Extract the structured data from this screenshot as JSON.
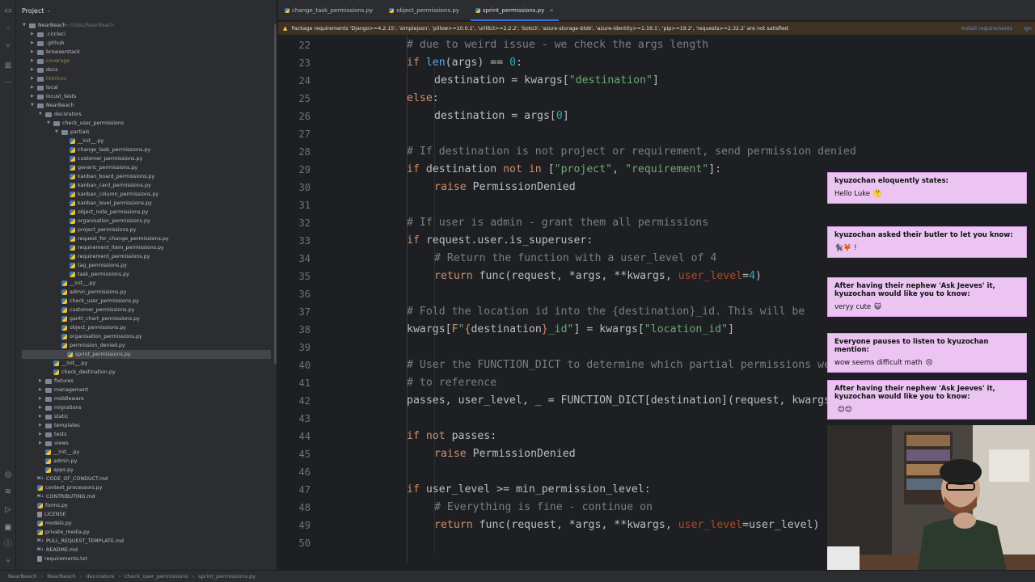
{
  "project": {
    "title": "Project",
    "root": "NearBeach",
    "root_path": "~/Sites/NearBeach",
    "tree": [
      {
        "label": "NearBeach",
        "kind": "folder",
        "depth": 0,
        "open": true
      },
      {
        "label": ".circleci",
        "kind": "folder",
        "depth": 1
      },
      {
        "label": ".github",
        "kind": "folder",
        "depth": 1
      },
      {
        "label": "browserstack",
        "kind": "folder",
        "depth": 1
      },
      {
        "label": "coverage",
        "kind": "folder",
        "depth": 1,
        "dim": true
      },
      {
        "label": "docs",
        "kind": "folder",
        "depth": 1
      },
      {
        "label": "htmlcov",
        "kind": "folder",
        "depth": 1,
        "dim": true
      },
      {
        "label": "local",
        "kind": "folder",
        "depth": 1
      },
      {
        "label": "locust_tests",
        "kind": "folder",
        "depth": 1
      },
      {
        "label": "NearBeach",
        "kind": "folder",
        "depth": 1,
        "open": true
      },
      {
        "label": "decorators",
        "kind": "folder",
        "depth": 2,
        "open": true
      },
      {
        "label": "check_user_permissions",
        "kind": "folder",
        "depth": 3,
        "open": true
      },
      {
        "label": "partials",
        "kind": "folder",
        "depth": 4,
        "open": true
      },
      {
        "label": "__init__.py",
        "kind": "py",
        "depth": 5
      },
      {
        "label": "change_task_permissions.py",
        "kind": "py",
        "depth": 5
      },
      {
        "label": "customer_permissions.py",
        "kind": "py",
        "depth": 5
      },
      {
        "label": "generic_permissions.py",
        "kind": "py",
        "depth": 5
      },
      {
        "label": "kanban_board_permissions.py",
        "kind": "py",
        "depth": 5
      },
      {
        "label": "kanban_card_permissions.py",
        "kind": "py",
        "depth": 5
      },
      {
        "label": "kanban_column_permissions.py",
        "kind": "py",
        "depth": 5
      },
      {
        "label": "kanban_level_permissions.py",
        "kind": "py",
        "depth": 5
      },
      {
        "label": "object_note_permissions.py",
        "kind": "py",
        "depth": 5
      },
      {
        "label": "organisation_permissions.py",
        "kind": "py",
        "depth": 5
      },
      {
        "label": "project_permissions.py",
        "kind": "py",
        "depth": 5
      },
      {
        "label": "request_for_change_permissions.py",
        "kind": "py",
        "depth": 5
      },
      {
        "label": "requirement_item_permissions.py",
        "kind": "py",
        "depth": 5
      },
      {
        "label": "requirement_permissions.py",
        "kind": "py",
        "depth": 5
      },
      {
        "label": "tag_permissions.py",
        "kind": "py",
        "depth": 5
      },
      {
        "label": "task_permissions.py",
        "kind": "py",
        "depth": 5
      },
      {
        "label": "__init__.py",
        "kind": "py",
        "depth": 4
      },
      {
        "label": "admin_permissions.py",
        "kind": "py",
        "depth": 4
      },
      {
        "label": "check_user_permissions.py",
        "kind": "py",
        "depth": 4
      },
      {
        "label": "customer_permissions.py",
        "kind": "py",
        "depth": 4
      },
      {
        "label": "gantt_chart_permissions.py",
        "kind": "py",
        "depth": 4
      },
      {
        "label": "object_permissions.py",
        "kind": "py",
        "depth": 4
      },
      {
        "label": "organisation_permissions.py",
        "kind": "py",
        "depth": 4
      },
      {
        "label": "permission_denied.py",
        "kind": "py",
        "depth": 4
      },
      {
        "label": "sprint_permissions.py",
        "kind": "py",
        "depth": 4,
        "selected": true
      },
      {
        "label": "__init__.py",
        "kind": "py",
        "depth": 3
      },
      {
        "label": "check_destination.py",
        "kind": "py",
        "depth": 3
      },
      {
        "label": "fixtures",
        "kind": "folder",
        "depth": 2
      },
      {
        "label": "management",
        "kind": "folder",
        "depth": 2
      },
      {
        "label": "middleware",
        "kind": "folder",
        "depth": 2
      },
      {
        "label": "migrations",
        "kind": "folder",
        "depth": 2
      },
      {
        "label": "static",
        "kind": "folder",
        "depth": 2
      },
      {
        "label": "templates",
        "kind": "folder",
        "depth": 2
      },
      {
        "label": "tests",
        "kind": "folder",
        "depth": 2
      },
      {
        "label": "views",
        "kind": "folder",
        "depth": 2
      },
      {
        "label": "__init__.py",
        "kind": "py",
        "depth": 2
      },
      {
        "label": "admin.py",
        "kind": "py",
        "depth": 2
      },
      {
        "label": "apps.py",
        "kind": "py",
        "depth": 2
      },
      {
        "label": "CODE_OF_CONDUCT.md",
        "kind": "md",
        "depth": 1
      },
      {
        "label": "context_processors.py",
        "kind": "py",
        "depth": 1
      },
      {
        "label": "CONTRIBUTING.md",
        "kind": "md",
        "depth": 1
      },
      {
        "label": "forms.py",
        "kind": "py",
        "depth": 1
      },
      {
        "label": "LICENSE",
        "kind": "txt",
        "depth": 1
      },
      {
        "label": "models.py",
        "kind": "py",
        "depth": 1
      },
      {
        "label": "private_media.py",
        "kind": "py",
        "depth": 1
      },
      {
        "label": "PULL_REQUEST_TEMPLATE.md",
        "kind": "md",
        "depth": 1
      },
      {
        "label": "README.md",
        "kind": "md",
        "depth": 1
      },
      {
        "label": "requirements.txt",
        "kind": "txt",
        "depth": 1
      }
    ]
  },
  "tabs": [
    {
      "label": "change_task_permissions.py",
      "active": false
    },
    {
      "label": "object_permissions.py",
      "active": false
    },
    {
      "label": "sprint_permissions.py",
      "active": true
    }
  ],
  "banner": {
    "text": "Package requirements 'Django>=4.2.15', 'simplejson', 'pillow>=10.0.1', 'urllib3>=2.2.2', 'boto3', 'azure-storage-blob', 'azure-identity>=1.16.1', 'pip>=19.2', 'requests>=2.32.2' are not satisfied",
    "action": "Install requirements",
    "action2": "Ign"
  },
  "code_lines": [
    {
      "n": "22",
      "indent": 0,
      "html": "<span class=\"cm\"># due to weird issue - we check the args length</span>"
    },
    {
      "n": "23",
      "indent": 0,
      "html": "<span class=\"kw\">if</span> <span class=\"fn\">len</span>(args) == <span class=\"num\">0</span>:"
    },
    {
      "n": "24",
      "indent": 1,
      "html": "destination = kwargs[<span class=\"str\">\"destination\"</span>]"
    },
    {
      "n": "25",
      "indent": 0,
      "html": "<span class=\"kw\">else</span>:"
    },
    {
      "n": "26",
      "indent": 1,
      "html": "destination = args[<span class=\"num\">0</span>]"
    },
    {
      "n": "27",
      "indent": 0,
      "html": ""
    },
    {
      "n": "28",
      "indent": 0,
      "html": "<span class=\"cm\"># If destination is not project or requirement, send permission denied</span>"
    },
    {
      "n": "29",
      "indent": 0,
      "html": "<span class=\"kw\">if</span> destination <span class=\"kw\">not in</span> [<span class=\"str\">\"project\"</span>, <span class=\"str\">\"requirement\"</span>]:"
    },
    {
      "n": "30",
      "indent": 1,
      "html": "<span class=\"kw\">raise</span> PermissionDenied"
    },
    {
      "n": "31",
      "indent": 0,
      "html": ""
    },
    {
      "n": "32",
      "indent": 0,
      "html": "<span class=\"cm\"># If user is admin - grant them all permissions</span>"
    },
    {
      "n": "33",
      "indent": 0,
      "html": "<span class=\"kw\">if</span> request.user.is_superuser:"
    },
    {
      "n": "34",
      "indent": 1,
      "html": "<span class=\"cm\"># Return the function with a user_level of 4</span>"
    },
    {
      "n": "35",
      "indent": 1,
      "html": "<span class=\"kw\">return</span> func(request, *args, **kwargs, <span class=\"par\">user_level</span>=<span class=\"num\">4</span>)"
    },
    {
      "n": "36",
      "indent": 0,
      "html": ""
    },
    {
      "n": "37",
      "indent": 0,
      "html": "<span class=\"cm\"># Fold the location id into the {destination}_id. This will be</span>"
    },
    {
      "n": "38",
      "indent": 0,
      "html": "kwargs[<span class=\"fs\">F</span><span class=\"str\">\"</span><span class=\"fs\">{</span>destination<span class=\"fs\">}</span><span class=\"str\">_id\"</span>] = kwargs[<span class=\"str\">\"location_id\"</span>]"
    },
    {
      "n": "39",
      "indent": 0,
      "html": ""
    },
    {
      "n": "40",
      "indent": 0,
      "html": "<span class=\"cm\"># User the FUNCTION_DICT to determine which partial permissions we need</span>"
    },
    {
      "n": "41",
      "indent": 0,
      "html": "<span class=\"cm\"># to reference</span>"
    },
    {
      "n": "42",
      "indent": 0,
      "html": "passes, user_level, _ = FUNCTION_DICT[destination](request, kwargs)"
    },
    {
      "n": "43",
      "indent": 0,
      "html": ""
    },
    {
      "n": "44",
      "indent": 0,
      "html": "<span class=\"kw\">if not</span> passes:"
    },
    {
      "n": "45",
      "indent": 1,
      "html": "<span class=\"kw\">raise</span> PermissionDenied"
    },
    {
      "n": "46",
      "indent": 0,
      "html": ""
    },
    {
      "n": "47",
      "indent": 0,
      "html": "<span class=\"kw\">if</span> user_level >= min_permission_level:"
    },
    {
      "n": "48",
      "indent": 1,
      "html": "<span class=\"cm\"># Everything is fine - continue on</span>"
    },
    {
      "n": "49",
      "indent": 1,
      "html": "<span class=\"kw\">return</span> func(request, *args, **kwargs, <span class=\"par\">user_level</span>=user_level)"
    },
    {
      "n": "50",
      "indent": 0,
      "html": ""
    }
  ],
  "chat": [
    {
      "title": "kyuzochan eloquently states:",
      "body": "Hello Luke",
      "emoji": "🤔"
    },
    {
      "title": "kyuzochan asked their butler to let you know:",
      "body": "!",
      "emoji": "🐈‍⬛🦊"
    },
    {
      "title": "After having their nephew 'Ask Jeeves' it, kyuzochan would like you to know:",
      "body": "veryy cute",
      "emoji": "😺"
    },
    {
      "title": "Everyone pauses to listen to kyuzochan mention:",
      "body": "wow seems difficult math",
      "emoji": "😣"
    },
    {
      "title": "After having their nephew 'Ask Jeeves' it, kyuzochan would like you to know:",
      "body": "",
      "emoji": "😊😊"
    }
  ],
  "breadcrumb": [
    "NearBeach",
    "NearBeach",
    "decorators",
    "check_user_permissions",
    "sprint_permissions.py"
  ]
}
